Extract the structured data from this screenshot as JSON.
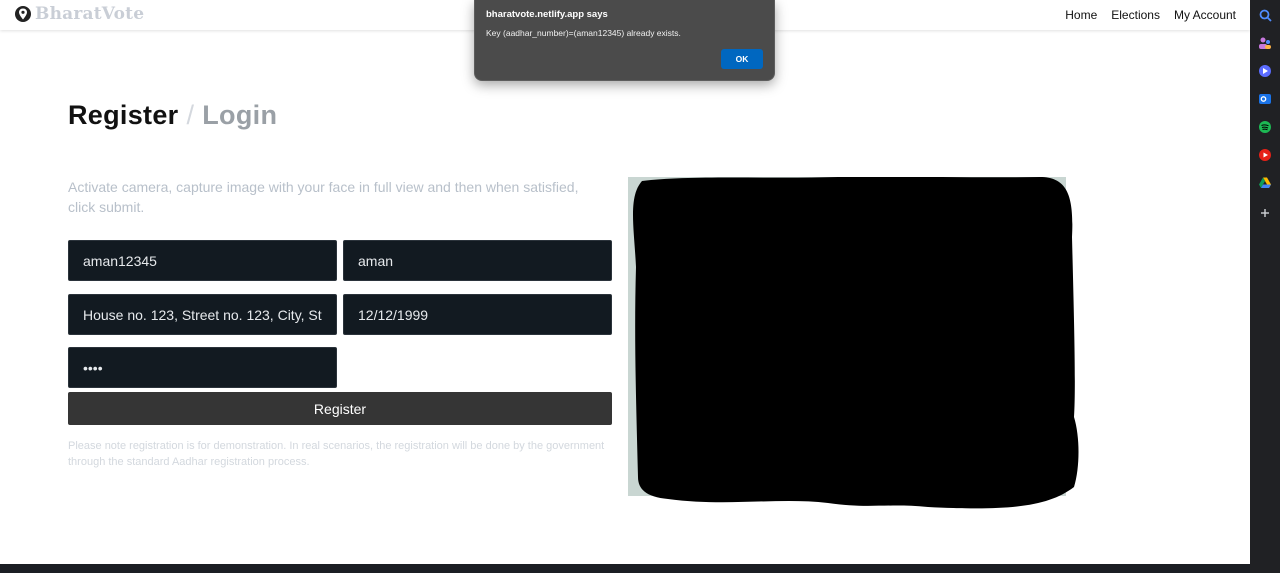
{
  "navbar": {
    "brand": "BharatVote",
    "links": [
      "Home",
      "Elections",
      "My Account"
    ]
  },
  "heading": {
    "register": "Register",
    "separator": "/",
    "login": "Login"
  },
  "instruction": "Activate camera, capture image with your face in full view and then when satisfied, click submit.",
  "form": {
    "aadhar_number": "aman12345",
    "name": "aman",
    "address": "House no. 123, Street no. 123, City, State",
    "dob": "12/12/1999",
    "password": "••••",
    "register_button": "Register"
  },
  "note": "Please note registration is for demonstration. In real scenarios, the registration will be done by the government through the standard Aadhar registration process.",
  "alert": {
    "title": "bharatvote.netlify.app says",
    "message": "Key (aadhar_number)=(aman12345) already exists.",
    "ok": "OK"
  },
  "sidebar_icons": [
    "search-icon",
    "people-icon",
    "copilot-icon",
    "outlook-icon",
    "spotify-icon",
    "youtube-icon",
    "drive-icon",
    "plus-icon"
  ],
  "colors": {
    "brand": "#c9ced6",
    "field_bg": "#121a21",
    "button_bg": "#353535",
    "alert_bg": "#4b4b4b",
    "alert_button": "#0067c0"
  }
}
